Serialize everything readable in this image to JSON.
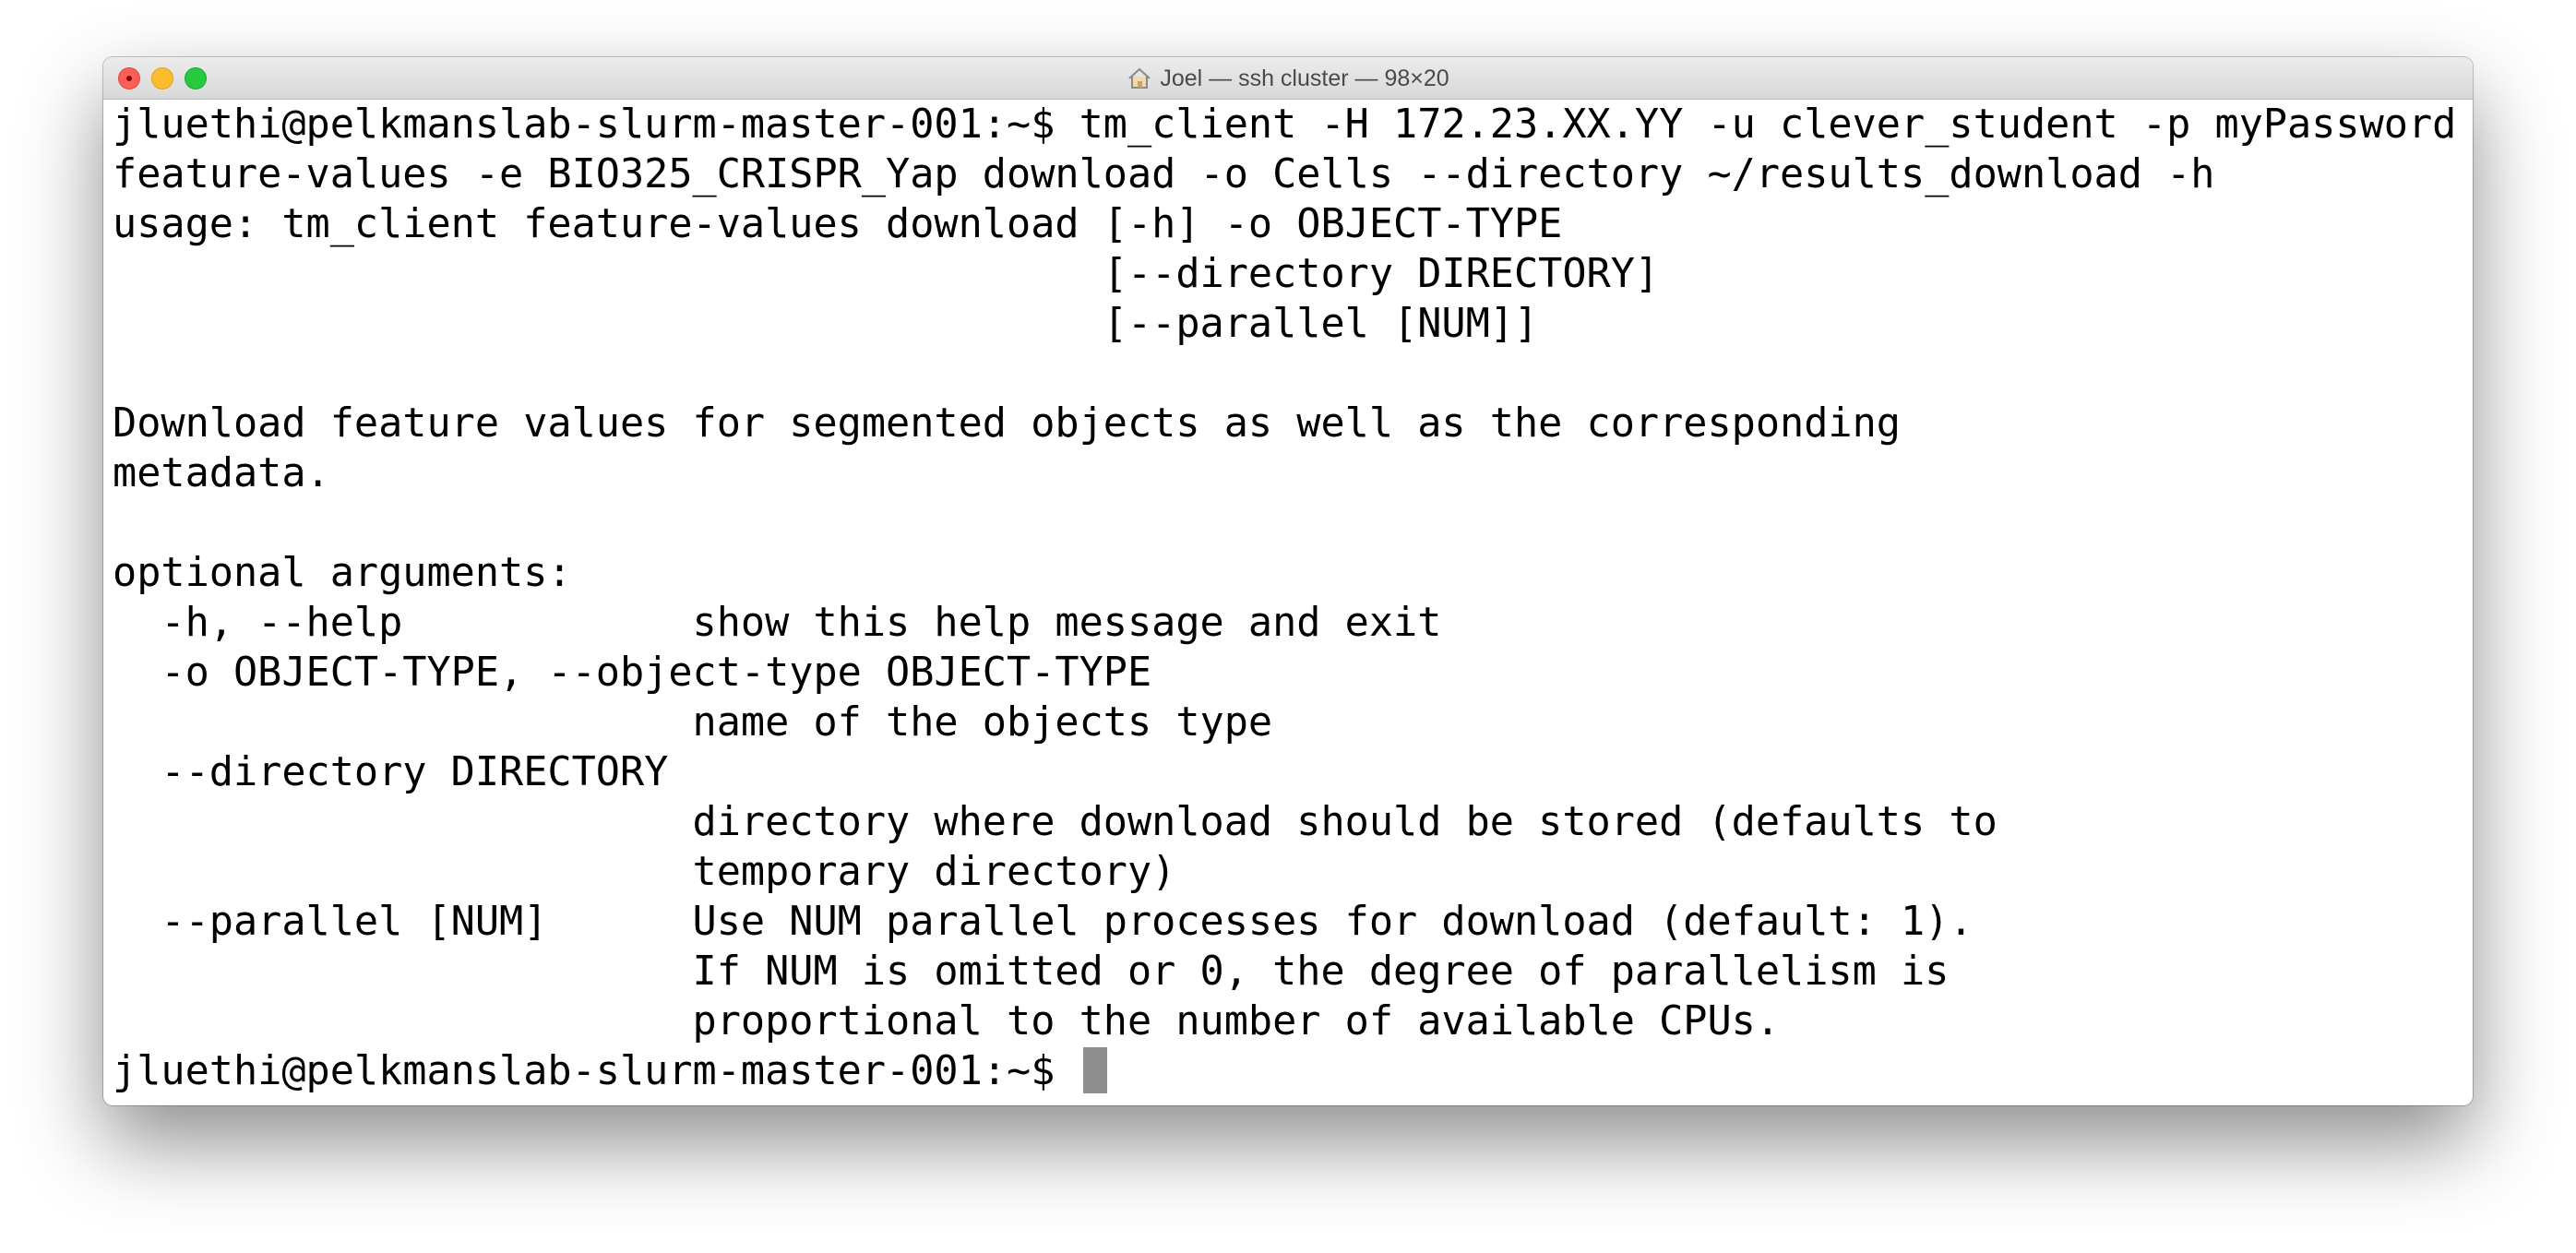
{
  "window": {
    "title": "Joel — ssh cluster — 98×20",
    "title_icon": "home-icon"
  },
  "terminal": {
    "lines": [
      "jluethi@pelkmanslab-slurm-master-001:~$ tm_client -H 172.23.XX.YY -u clever_student -p myPassword",
      "feature-values -e BIO325_CRISPR_Yap download -o Cells --directory ~/results_download -h",
      "usage: tm_client feature-values download [-h] -o OBJECT-TYPE",
      "                                         [--directory DIRECTORY]",
      "                                         [--parallel [NUM]]",
      "",
      "Download feature values for segmented objects as well as the corresponding",
      "metadata.",
      "",
      "optional arguments:",
      "  -h, --help            show this help message and exit",
      "  -o OBJECT-TYPE, --object-type OBJECT-TYPE",
      "                        name of the objects type",
      "  --directory DIRECTORY",
      "                        directory where download should be stored (defaults to",
      "                        temporary directory)",
      "  --parallel [NUM]      Use NUM parallel processes for download (default: 1).",
      "                        If NUM is omitted or 0, the degree of parallelism is",
      "                        proportional to the number of available CPUs."
    ],
    "prompt": "jluethi@pelkmanslab-slurm-master-001:~$ "
  }
}
